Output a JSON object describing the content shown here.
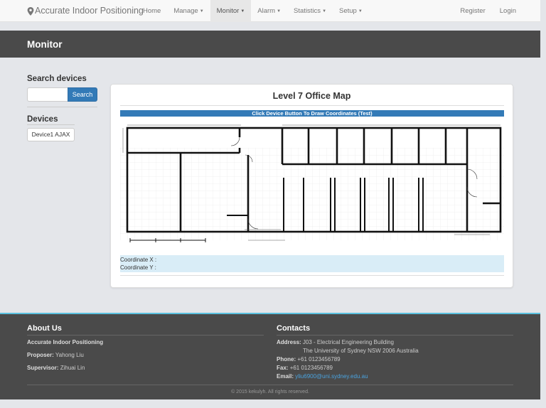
{
  "navbar": {
    "brand": "Accurate Indoor Positioning",
    "items": [
      {
        "label": "Home",
        "dropdown": false,
        "active": false
      },
      {
        "label": "Manage",
        "dropdown": true,
        "active": false
      },
      {
        "label": "Monitor",
        "dropdown": true,
        "active": true
      },
      {
        "label": "Alarm",
        "dropdown": true,
        "active": false
      },
      {
        "label": "Statistics",
        "dropdown": true,
        "active": false
      },
      {
        "label": "Setup",
        "dropdown": true,
        "active": false
      }
    ],
    "right": [
      {
        "label": "Register"
      },
      {
        "label": "Login"
      }
    ]
  },
  "header": {
    "title": "Monitor"
  },
  "sidebar": {
    "search_title": "Search devices",
    "search_value": "",
    "search_placeholder": "",
    "search_button": "Search",
    "devices_title": "Devices",
    "devices": [
      {
        "label": "Device1 AJAX"
      }
    ]
  },
  "main": {
    "map_title": "Level 7 Office Map",
    "draw_button": "Click Device Button To Draw Coordinates (Test)",
    "coord_x_label": "Coordinate X :",
    "coord_y_label": "Coordinate Y :"
  },
  "footer": {
    "about_title": "About Us",
    "about_org": "Accurate Indoor Positioning",
    "proposer_label": "Proposer:",
    "proposer_name": "Yahong Liu",
    "supervisor_label": "Supervisor:",
    "supervisor_name": "Zihuai Lin",
    "contacts_title": "Contacts",
    "address_label": "Address:",
    "address_line1": "J03 - Electrical Engineering Building",
    "address_line2": "The University of Sydney NSW 2006 Australia",
    "phone_label": "Phone:",
    "phone": "+61 0123456789",
    "fax_label": "Fax:",
    "fax": "+61 0123456789",
    "email_label": "Email:",
    "email": "yliu6900@uni.sydney.edu.au",
    "copyright": "© 2015 kekulyh. All rights reserved."
  },
  "colors": {
    "primary": "#337ab7",
    "dark_band": "#4a4a4a",
    "coord_bg": "#d9edf7",
    "footer_accent": "#5bc0de"
  }
}
